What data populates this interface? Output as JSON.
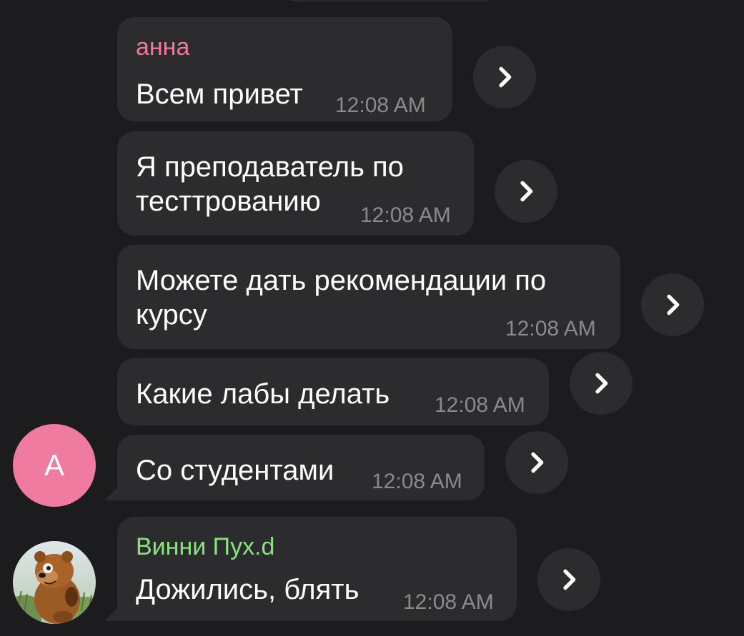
{
  "colors": {
    "background": "#1c1c1e",
    "bubble": "#2c2c2e",
    "sender_anna": "#f0799a",
    "sender_winnie": "#8ae27f",
    "avatar_anna": "#ef7ba0",
    "time": "#8a8a8e"
  },
  "messages": [
    {
      "sender": "анна",
      "text": "Всем привет",
      "time": "12:08 AM"
    },
    {
      "text": "Я преподаватель по\nтесттрованию",
      "time": "12:08 AM"
    },
    {
      "text": "Можете дать рекомендации по\nкурсу",
      "time": "12:08 AM"
    },
    {
      "text": "Какие лабы делать",
      "time": "12:08 AM"
    },
    {
      "text": "Со студентами",
      "time": "12:08 AM"
    },
    {
      "sender": "Винни Пух.d",
      "text": "Дожились, блять",
      "time": "12:08 AM"
    }
  ],
  "avatars": {
    "anna": {
      "letter": "А",
      "icon": "letter-avatar"
    },
    "winnie": {
      "icon": "winnie-the-pooh-avatar"
    }
  },
  "share_icon": "chevron-right-icon"
}
